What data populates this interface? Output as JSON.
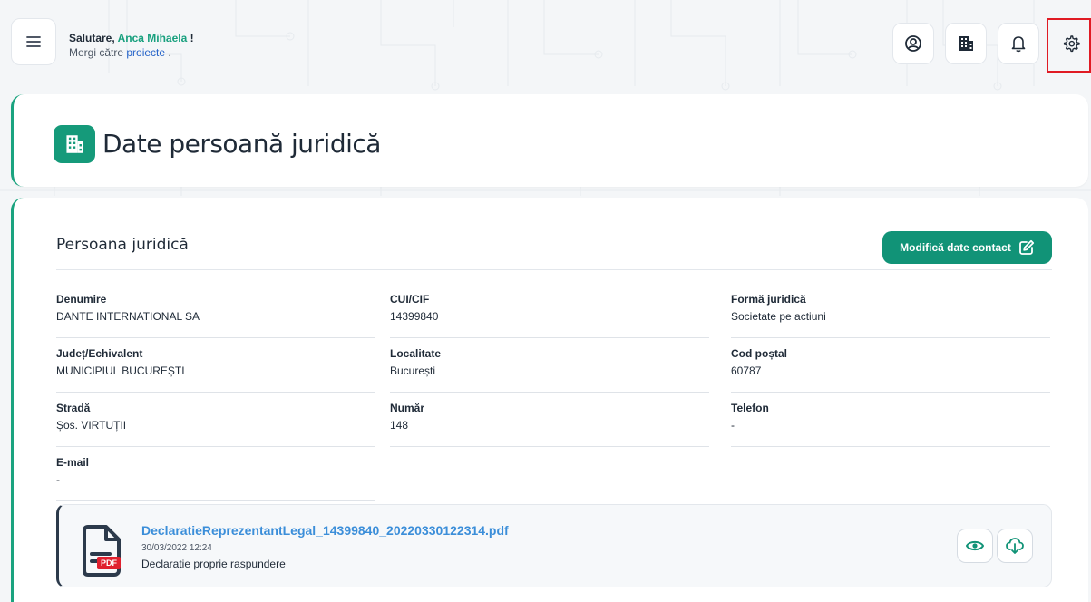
{
  "header": {
    "greeting_prefix": "Salutare, ",
    "user_name": "Anca Mihaela",
    "greeting_suffix": " !",
    "goto_prefix": "Mergi către ",
    "goto_link": "proiecte",
    "goto_suffix": " .",
    "icons": [
      "menu-icon",
      "profile-icon",
      "building-icon",
      "bell-icon",
      "gear-icon"
    ]
  },
  "page": {
    "title": "Date persoană juridică"
  },
  "section": {
    "title": "Persoana juridică",
    "edit_button": "Modifică date contact"
  },
  "fields": [
    {
      "label": "Denumire",
      "value": "DANTE INTERNATIONAL SA"
    },
    {
      "label": "CUI/CIF",
      "value": "14399840"
    },
    {
      "label": "Formă juridică",
      "value": "Societate pe actiuni"
    },
    {
      "label": "Județ/Echivalent",
      "value": "MUNICIPIUL BUCUREȘTI"
    },
    {
      "label": "Localitate",
      "value": "București"
    },
    {
      "label": "Cod poștal",
      "value": "60787"
    },
    {
      "label": "Stradă",
      "value": "Șos. VIRTUȚII"
    },
    {
      "label": "Număr",
      "value": "148"
    },
    {
      "label": "Telefon",
      "value": "-"
    },
    {
      "label": "E-mail",
      "value": "-"
    }
  ],
  "file": {
    "name": "DeclaratieReprezentantLegal_14399840_20220330122314.pdf",
    "date": "30/03/2022 12:24",
    "description": "Declaratie proprie raspundere",
    "badge": "PDF"
  },
  "colors": {
    "accent": "#119377",
    "link": "#3b8ed9",
    "highlight": "#e01b24"
  }
}
